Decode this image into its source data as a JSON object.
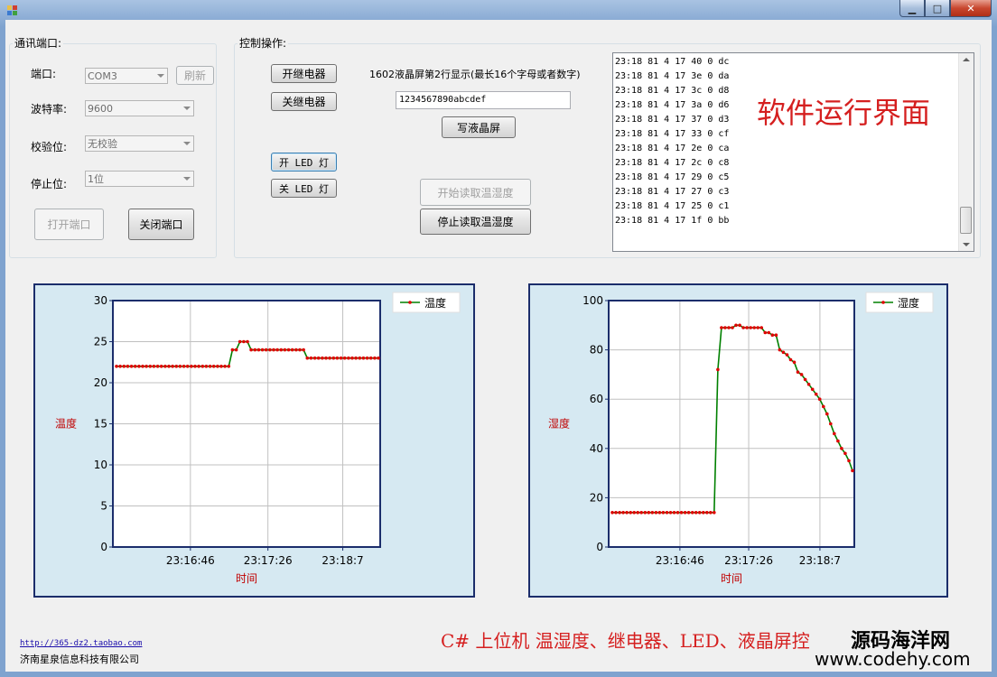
{
  "window": {
    "buttons": {
      "minimize": "▁",
      "maximize": "□",
      "close": "✕"
    }
  },
  "comm": {
    "group_label": "通讯端口:",
    "port_label": "端口:",
    "port_value": "COM3",
    "refresh_label": "刷新",
    "baud_label": "波特率:",
    "baud_value": "9600",
    "parity_label": "校验位:",
    "parity_value": "无校验",
    "stop_label": "停止位:",
    "stop_value": "1位",
    "open_label": "打开端口",
    "close_label": "关闭端口"
  },
  "control": {
    "group_label": "控制操作:",
    "relay_on": "开继电器",
    "relay_off": "关继电器",
    "lcd_label": "1602液晶屏第2行显示(最长16个字母或者数字)",
    "lcd_value": "1234567890abcdef",
    "lcd_write": "写液晶屏",
    "led_on": "开 LED 灯",
    "led_off": "关 LED 灯",
    "start_read": "开始读取温湿度",
    "stop_read": "停止读取温湿度"
  },
  "log": {
    "lines": [
      "23:18 81 4 17 40 0 dc",
      "23:18 81 4 17 3e 0 da",
      "23:18 81 4 17 3c 0 d8",
      "23:18 81 4 17 3a 0 d6",
      "23:18 81 4 17 37 0 d3",
      "23:18 81 4 17 33 0 cf",
      "23:18 81 4 17 2e 0 ca",
      "23:18 81 4 17 2c 0 c8",
      "23:18 81 4 17 29 0 c5",
      "23:18 81 4 17 27 0 c3",
      "23:18 81 4 17 25 0 c1",
      "23:18 81 4 17 1f 0 bb"
    ]
  },
  "overlay_title": "软件运行界面",
  "footer": {
    "link": "http://365-dz2.taobao.com",
    "company": "济南星泉信息科技有限公司"
  },
  "caption": "C# 上位机 温湿度、继电器、LED、液晶屏控",
  "watermark": {
    "line1": "源码海洋网",
    "line2": "www.codehy.com"
  },
  "colors": {
    "line": "#008000",
    "marker": "#e00000",
    "axis": "#1b2d6b",
    "label": "#c00000",
    "panel": "#d6e9f2"
  },
  "chart_data": [
    {
      "type": "line",
      "xlabel": "时间",
      "ylabel": "温度",
      "legend": [
        "温度"
      ],
      "legend_position": "top-right",
      "ylim": [
        0,
        30
      ],
      "yticks": [
        0,
        5,
        10,
        15,
        20,
        25,
        30
      ],
      "xtick_labels": [
        "23:16:46",
        "23:17:26",
        "23:18:7"
      ],
      "grid": true,
      "series": [
        {
          "name": "温度",
          "values": [
            22,
            22,
            22,
            22,
            22,
            22,
            22,
            22,
            22,
            22,
            22,
            22,
            22,
            22,
            22,
            22,
            22,
            22,
            22,
            22,
            22,
            22,
            22,
            22,
            22,
            22,
            22,
            22,
            22,
            22,
            22,
            24,
            24,
            25,
            25,
            25,
            24,
            24,
            24,
            24,
            24,
            24,
            24,
            24,
            24,
            24,
            24,
            24,
            24,
            24,
            24,
            23,
            23,
            23,
            23,
            23,
            23,
            23,
            23,
            23,
            23,
            23,
            23,
            23,
            23,
            23,
            23,
            23,
            23,
            23,
            23
          ]
        }
      ]
    },
    {
      "type": "line",
      "xlabel": "时间",
      "ylabel": "湿度",
      "legend": [
        "湿度"
      ],
      "legend_position": "top-right",
      "ylim": [
        0,
        100
      ],
      "yticks": [
        0,
        20,
        40,
        60,
        80,
        100
      ],
      "xtick_labels": [
        "23:16:46",
        "23:17:26",
        "23:18:7"
      ],
      "grid": true,
      "series": [
        {
          "name": "湿度",
          "values": [
            14,
            14,
            14,
            14,
            14,
            14,
            14,
            14,
            14,
            14,
            14,
            14,
            14,
            14,
            14,
            14,
            14,
            14,
            14,
            14,
            14,
            14,
            14,
            14,
            14,
            14,
            14,
            14,
            14,
            72,
            89,
            89,
            89,
            89,
            90,
            90,
            89,
            89,
            89,
            89,
            89,
            89,
            87,
            87,
            86,
            86,
            80,
            79,
            78,
            76,
            75,
            71,
            70,
            68,
            66,
            64,
            62,
            60,
            57,
            54,
            50,
            46,
            43,
            40,
            38,
            35,
            31
          ]
        }
      ]
    }
  ]
}
